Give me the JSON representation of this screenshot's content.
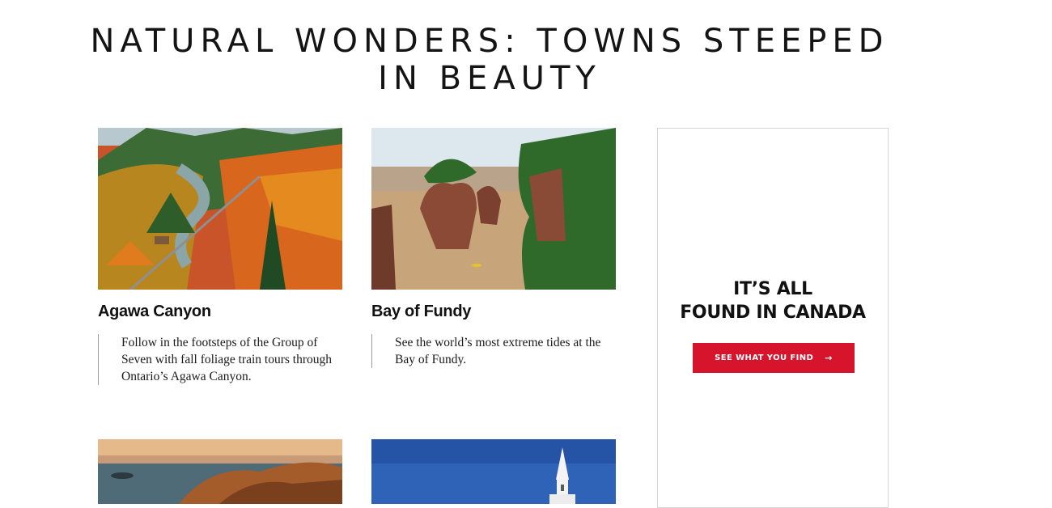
{
  "page": {
    "title": "NATURAL WONDERS: TOWNS STEEPED IN BEAUTY"
  },
  "cards": [
    {
      "title": "Agawa Canyon",
      "description": "Follow in the footsteps of the Group of Seven with fall foliage train tours through Ontario’s Agawa Canyon.",
      "image": "autumn-canyon-railway-photo"
    },
    {
      "title": "Bay of Fundy",
      "description": "See the world’s most extreme tides at the Bay of Fundy.",
      "image": "flowerpot-rocks-tidal-flats-photo"
    },
    {
      "image": "rocky-coastline-sunset-photo"
    },
    {
      "image": "white-church-steeple-blue-sky-photo"
    }
  ],
  "ad": {
    "headline_line1": "IT’S ALL",
    "headline_line2": "FOUND IN CANADA",
    "button_label": "SEE WHAT YOU FIND",
    "button_icon": "arrow-right-icon",
    "button_color": "#d6152d"
  }
}
